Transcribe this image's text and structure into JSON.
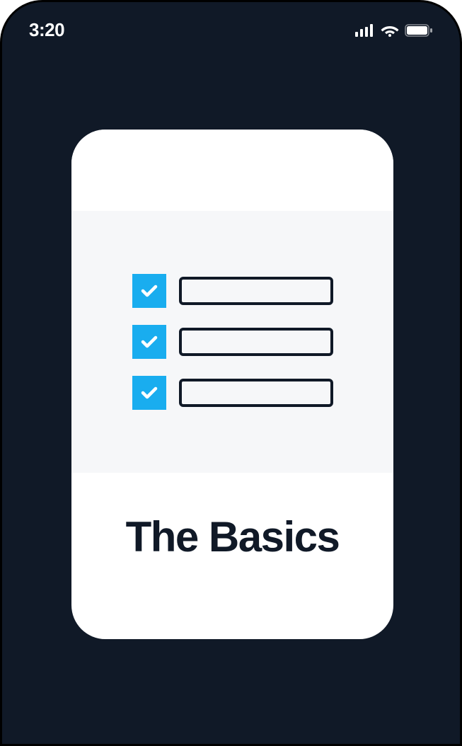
{
  "status_bar": {
    "time": "3:20",
    "signal_icon": "signal-icon",
    "wifi_icon": "wifi-icon",
    "battery_icon": "battery-icon"
  },
  "card": {
    "title": "The Basics",
    "accent_color": "#19adef",
    "checklist_items": [
      {
        "checked": true
      },
      {
        "checked": true
      },
      {
        "checked": true
      }
    ]
  }
}
